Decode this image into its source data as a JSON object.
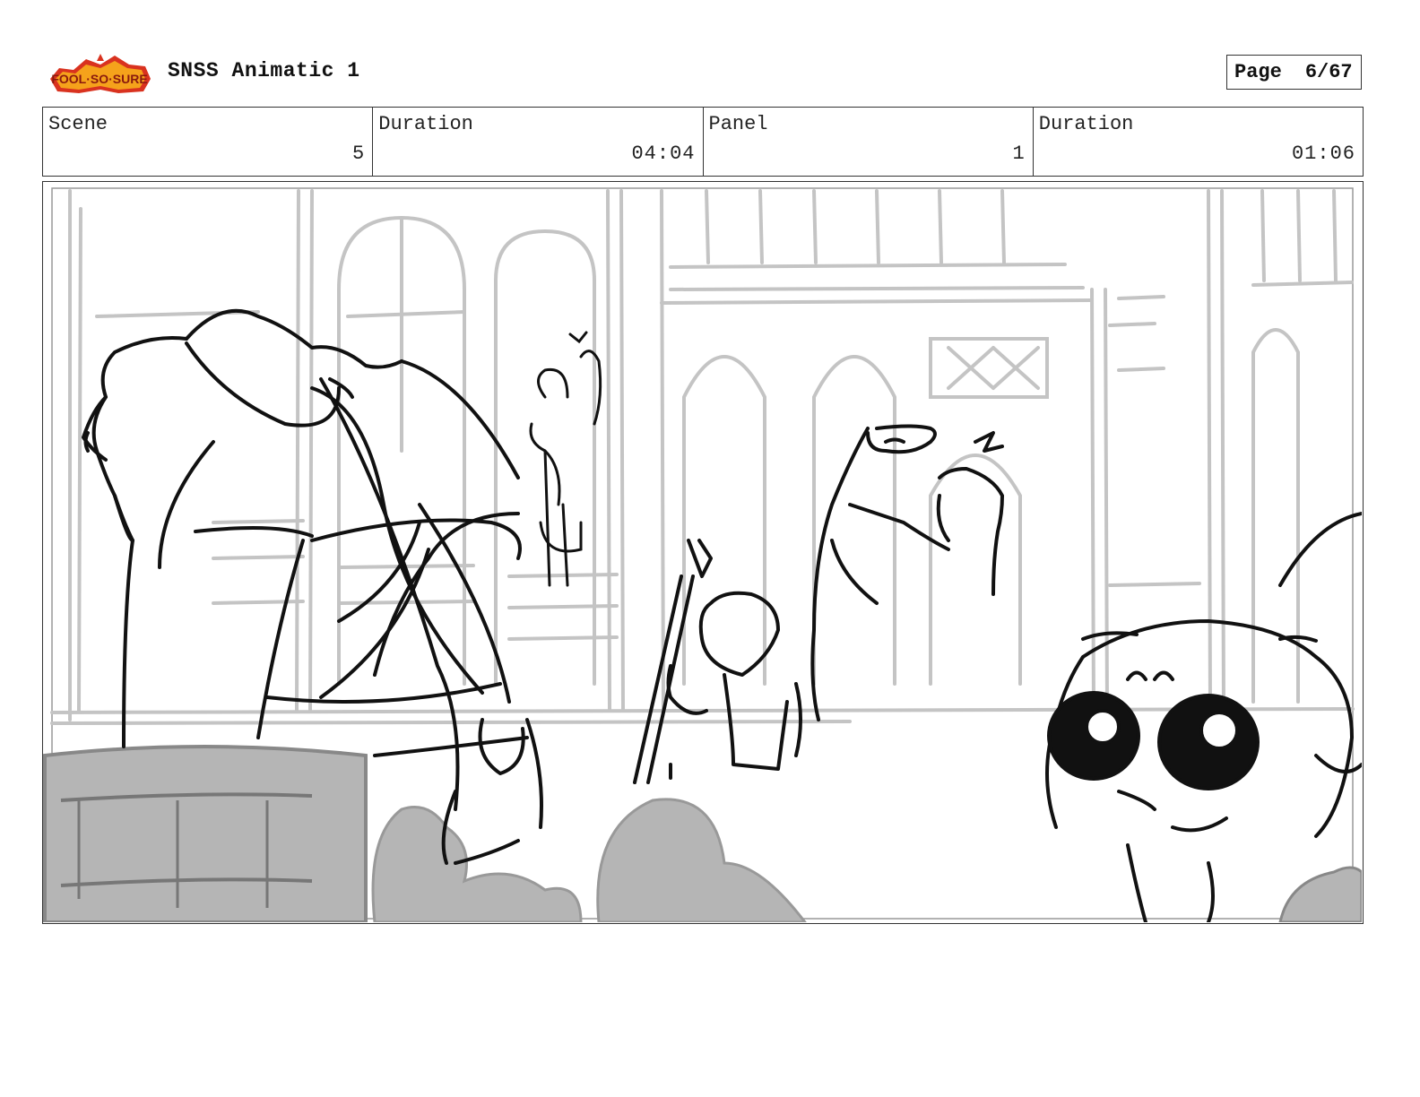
{
  "header": {
    "logo_text": "Sir Fool-So-Sure",
    "title": "SNSS Animatic 1",
    "page_label": "Page",
    "page_value": "6/67"
  },
  "info": {
    "scene_label": "Scene",
    "scene_value": "5",
    "scene_duration_label": "Duration",
    "scene_duration_value": "04:04",
    "panel_label": "Panel",
    "panel_value": "1",
    "panel_duration_label": "Duration",
    "panel_duration_value": "01:06"
  },
  "colors": {
    "logo_red": "#d9321f",
    "logo_orange": "#f5a21b",
    "sketch_grey": "#b9b9b9",
    "ink": "#111111"
  }
}
